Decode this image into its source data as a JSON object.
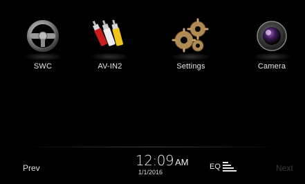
{
  "apps": [
    {
      "label": "SWC",
      "icon": "steering-wheel-icon"
    },
    {
      "label": "AV-IN2",
      "icon": "av-cables-icon"
    },
    {
      "label": "Settings",
      "icon": "gears-icon"
    },
    {
      "label": "Camera",
      "icon": "camera-lens-icon"
    }
  ],
  "nav": {
    "prev_label": "Prev",
    "next_label": "Next"
  },
  "clock": {
    "time": "12:09",
    "ampm": "AM",
    "date": "1/1/2016"
  },
  "eq": {
    "label": "EQ",
    "icon": "equalizer-bars-icon"
  },
  "colors": {
    "background": "#000000",
    "text": "#e6e6e6",
    "disabled": "#3a3a3a"
  }
}
